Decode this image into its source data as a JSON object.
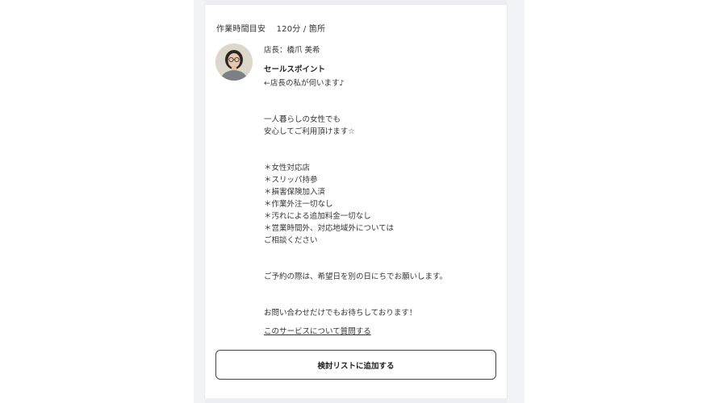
{
  "work_time": {
    "label": "作業時間目安",
    "value": "120分 / 箇所"
  },
  "owner": {
    "title_name": "店長：橋爪 美希",
    "avatar_icon": "person-photo-icon"
  },
  "sales_point": {
    "title": "セールスポイント",
    "body": "←店長の私が伺います♪\n\n\n一人暮らしの女性でも\n安心してご利用頂けます☆\n\n\n＊女性対応店\n＊スリッパ持参\n＊損害保険加入済\n＊作業外注一切なし\n＊汚れによる追加料金一切なし\n＊営業時間外、対応地域外については\nご相談ください\n\n\nご予約の際は、希望日を別の日にちでお願いします。\n\n\nお問い合わせだけでもお待ちしております！"
  },
  "question_link": "このサービスについて質問する",
  "add_button": "検討リストに追加する",
  "colors": {
    "background_band": "#f2f3f7",
    "card": "#ffffff",
    "text": "#333333",
    "button_border": "#444444"
  }
}
